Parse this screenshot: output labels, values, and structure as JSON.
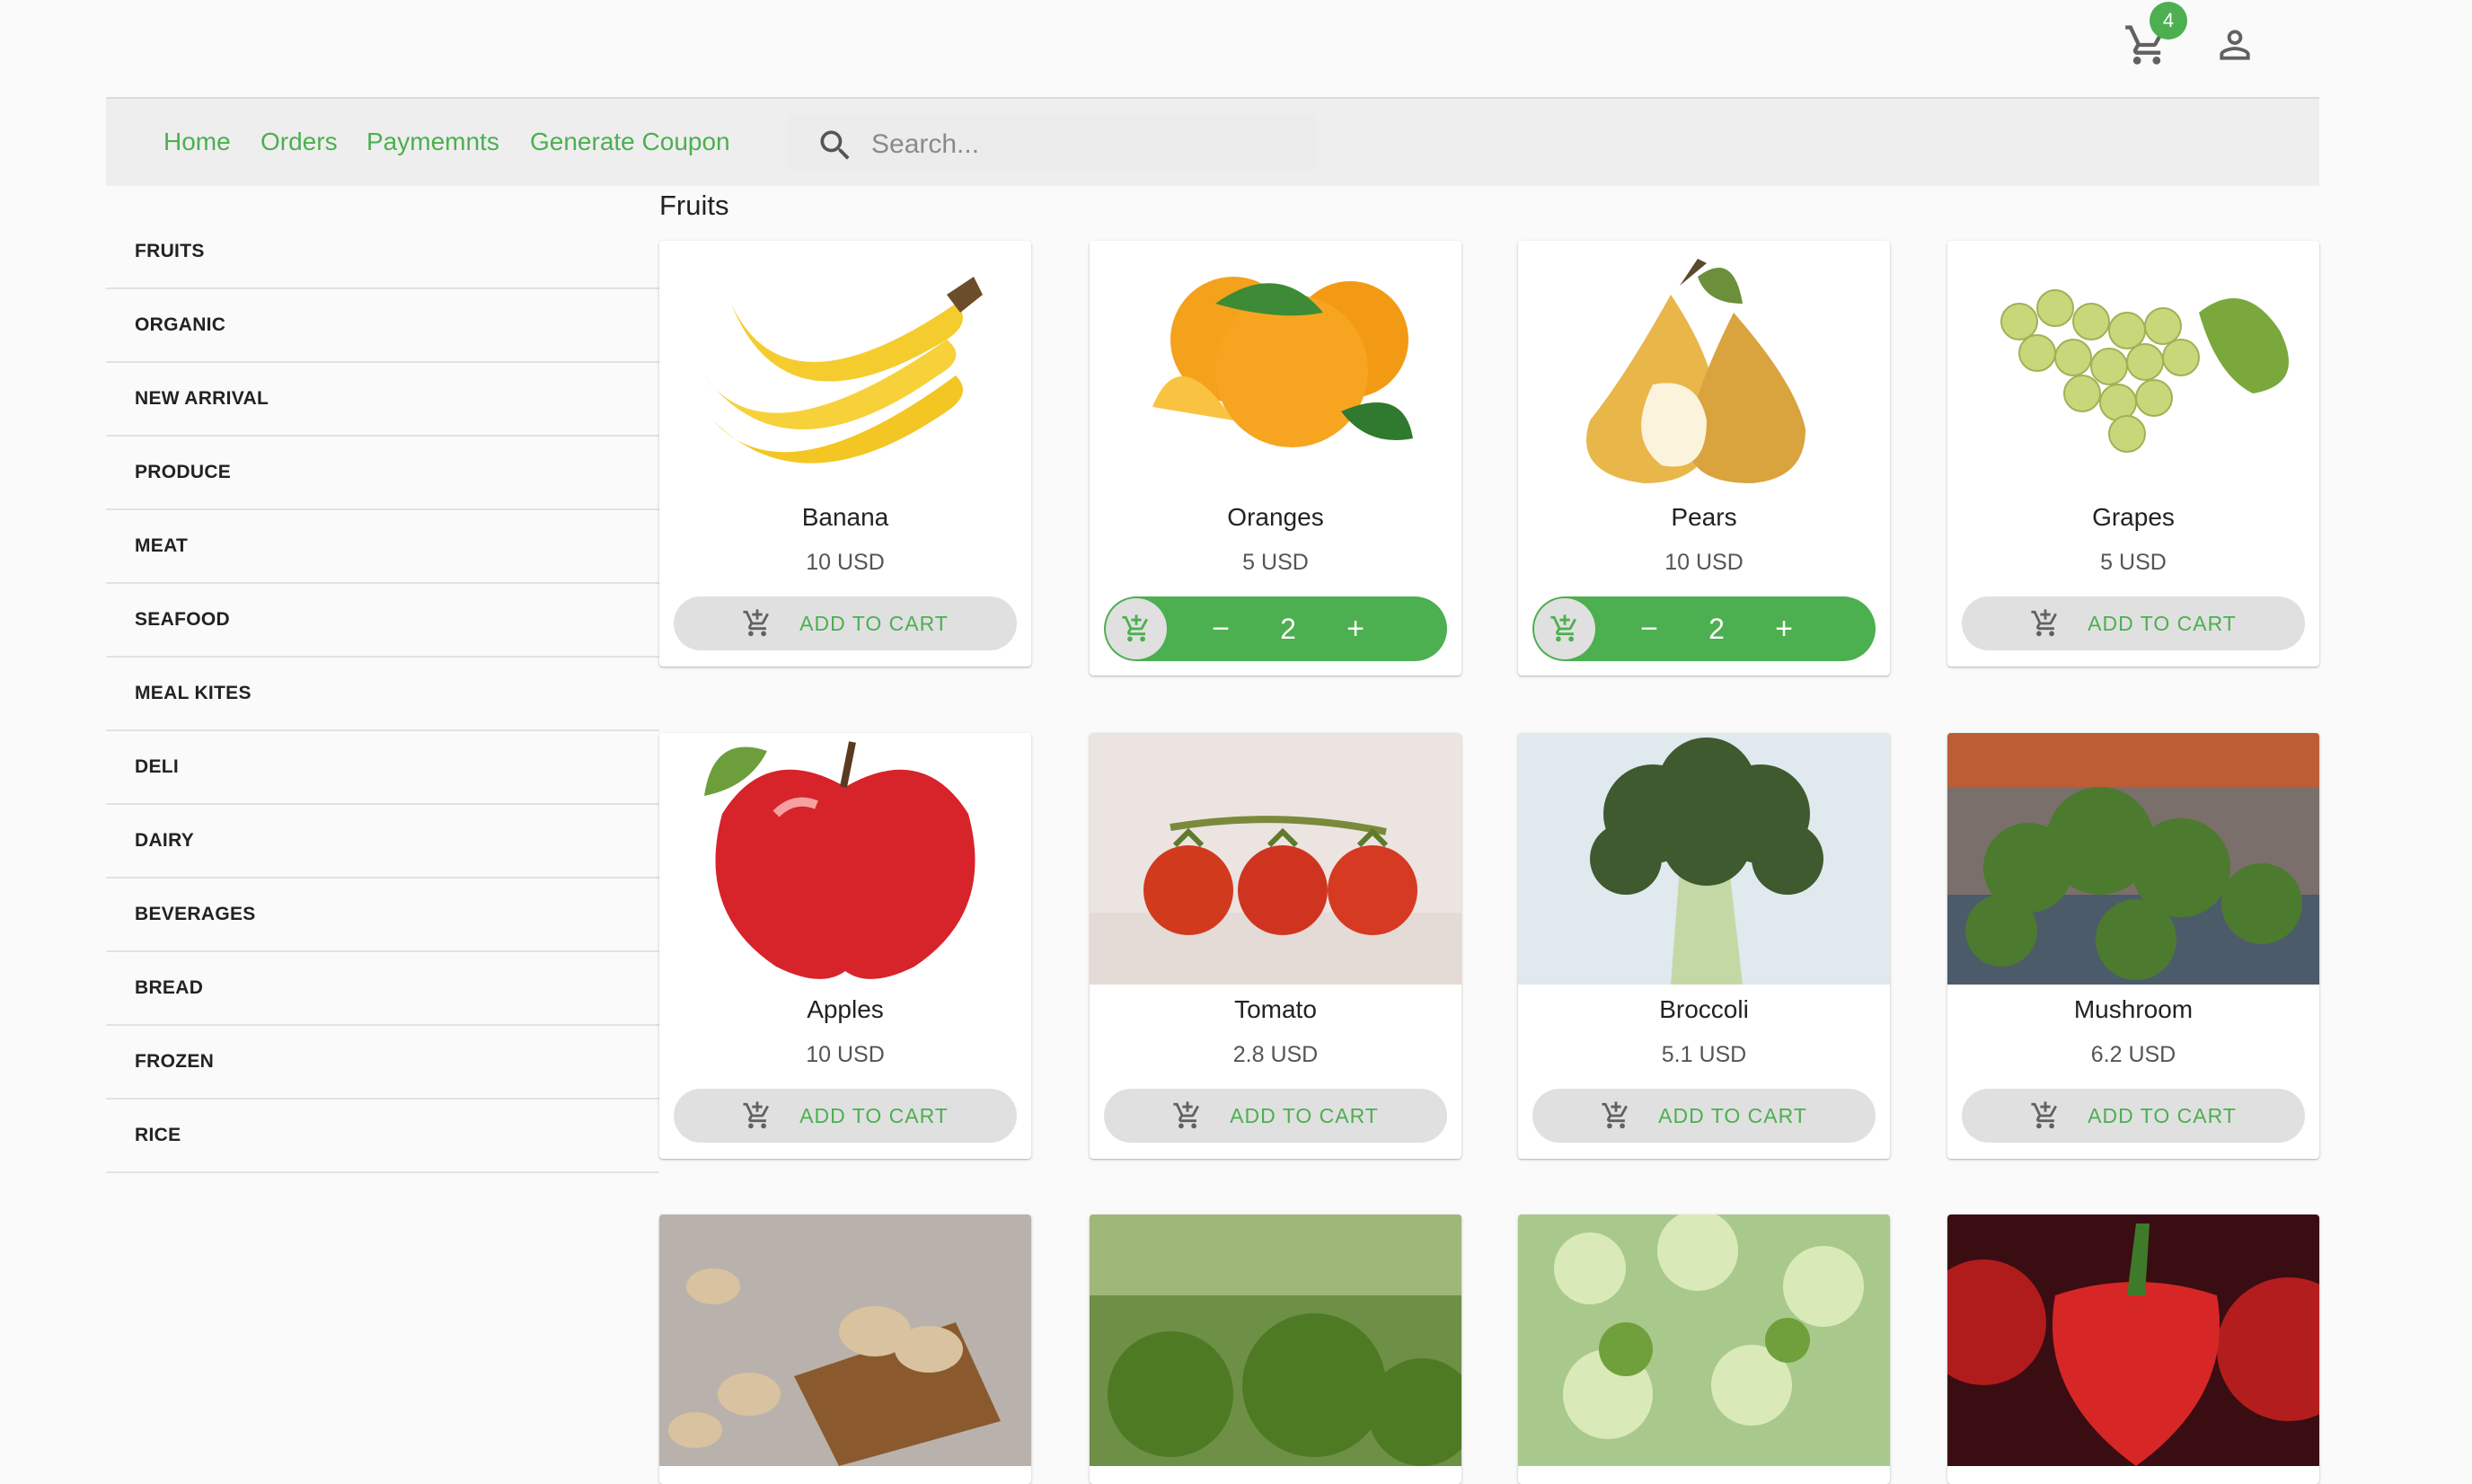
{
  "header": {
    "cart_count": "4"
  },
  "nav": {
    "links": [
      "Home",
      "Orders",
      "Paymemnts",
      "Generate Coupon"
    ],
    "search_placeholder": "Search..."
  },
  "sidebar": {
    "categories": [
      "FRUITS",
      "ORGANIC",
      "NEW ARRIVAL",
      "PRODUCE",
      "MEAT",
      "SEAFOOD",
      "MEAL KITES",
      "DELI",
      "DAIRY",
      "BEVERAGES",
      "BREAD",
      "FROZEN",
      "RICE"
    ]
  },
  "main": {
    "section_title": "Fruits",
    "add_label": "ADD TO CART",
    "products": [
      {
        "name": "Banana",
        "price": "10 USD",
        "in_cart": false
      },
      {
        "name": "Oranges",
        "price": "5 USD",
        "in_cart": true,
        "qty": "2"
      },
      {
        "name": "Pears",
        "price": "10 USD",
        "in_cart": true,
        "qty": "2"
      },
      {
        "name": "Grapes",
        "price": "5 USD",
        "in_cart": false
      },
      {
        "name": "Apples",
        "price": "10 USD",
        "in_cart": false
      },
      {
        "name": "Tomato",
        "price": "2.8 USD",
        "in_cart": false
      },
      {
        "name": "Broccoli",
        "price": "5.1 USD",
        "in_cart": false
      },
      {
        "name": "Mushroom",
        "price": "6.2 USD",
        "in_cart": false
      }
    ]
  },
  "colors": {
    "accent": "#4caf50",
    "nav_bg": "#eeeeee",
    "button_bg": "#e0e0e0"
  }
}
